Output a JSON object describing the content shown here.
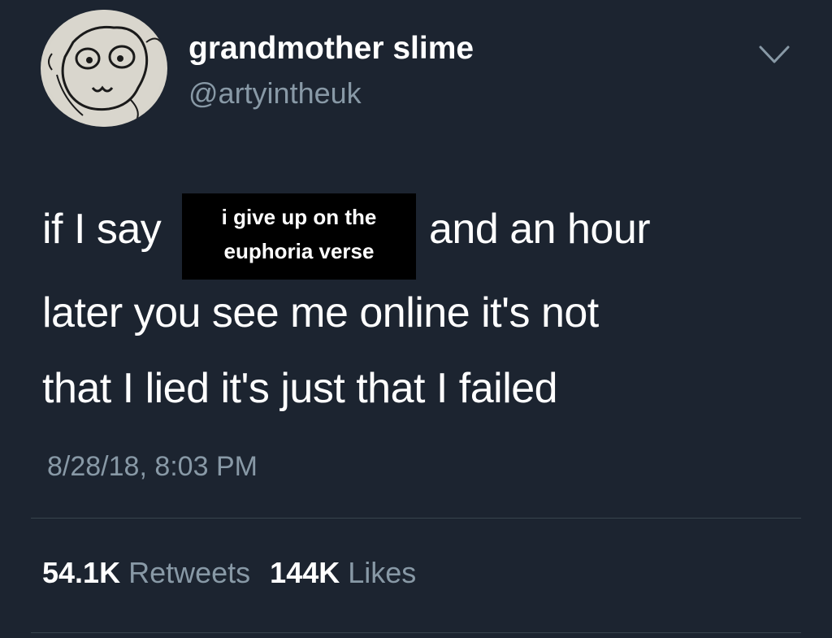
{
  "user": {
    "display_name": "grandmother slime",
    "handle": "@artyintheuk",
    "avatar_icon": "doodle-face-avatar"
  },
  "menu": {
    "icon": "chevron-down-icon"
  },
  "tweet": {
    "line1_start": "if I say",
    "line1_end": "and an hour",
    "line2": "later you see me online it's not",
    "line3": "that I lied it's just that I failed",
    "overlay_line1": "i give up on the",
    "overlay_line2": "euphoria verse"
  },
  "meta": {
    "timestamp": "8/28/18, 8:03 PM"
  },
  "stats": {
    "retweets_count": "54.1K",
    "retweets_label": "Retweets",
    "likes_count": "144K",
    "likes_label": "Likes"
  },
  "colors": {
    "background": "#1c2430",
    "text": "#ffffff",
    "secondary_text": "#8899a6",
    "divider": "#38444d",
    "overlay": "#000000"
  }
}
